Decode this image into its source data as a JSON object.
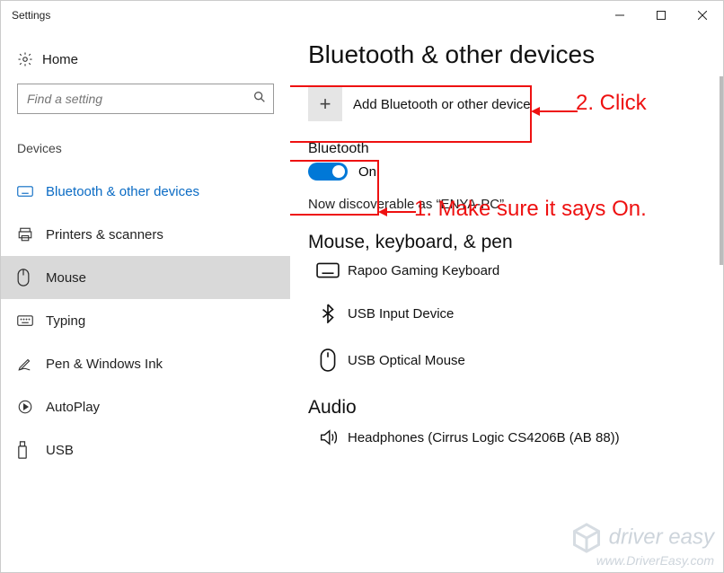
{
  "window": {
    "title": "Settings"
  },
  "sidebar": {
    "home_label": "Home",
    "search_placeholder": "Find a setting",
    "group_title": "Devices",
    "items": [
      {
        "label": "Bluetooth & other devices"
      },
      {
        "label": "Printers & scanners"
      },
      {
        "label": "Mouse"
      },
      {
        "label": "Typing"
      },
      {
        "label": "Pen & Windows Ink"
      },
      {
        "label": "AutoPlay"
      },
      {
        "label": "USB"
      }
    ]
  },
  "page": {
    "title": "Bluetooth & other devices",
    "add_label": "Add Bluetooth or other device",
    "bluetooth_label": "Bluetooth",
    "bluetooth_state": "On",
    "discoverable_text": "Now discoverable as “ENYA-PC”",
    "sections": {
      "mkp_title": "Mouse, keyboard, & pen",
      "audio_title": "Audio"
    },
    "devices_mkp": [
      {
        "name": "Rapoo Gaming Keyboard",
        "icon": "keyboard-icon"
      },
      {
        "name": "USB Input Device",
        "icon": "bluetooth-icon"
      },
      {
        "name": "USB Optical Mouse",
        "icon": "mouse-icon"
      }
    ],
    "devices_audio": [
      {
        "name": "Headphones (Cirrus Logic CS4206B (AB 88))",
        "icon": "speaker-icon"
      }
    ]
  },
  "annotations": {
    "step2": "2. Click",
    "step1": "1. Make sure it says On."
  },
  "watermark": {
    "line1": "driver easy",
    "line2": "www.DriverEasy.com"
  }
}
